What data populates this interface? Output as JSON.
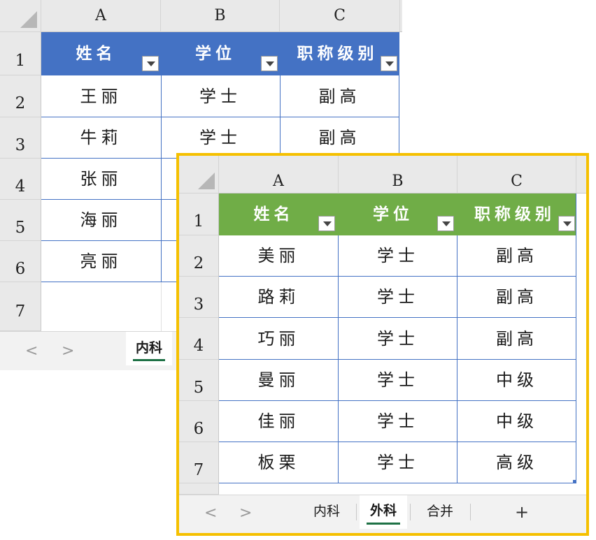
{
  "back_sheet": {
    "columns": [
      "A",
      "B",
      "C"
    ],
    "rows": [
      "1",
      "2",
      "3",
      "4",
      "5",
      "6",
      "7"
    ],
    "header_color": "#4472c4",
    "headers": [
      "姓名",
      "学位",
      "职称级别"
    ],
    "data": [
      [
        "王丽",
        "学士",
        "副高"
      ],
      [
        "牛莉",
        "学士",
        "副高"
      ],
      [
        "张丽",
        "",
        ""
      ],
      [
        "海丽",
        "",
        ""
      ],
      [
        "亮丽",
        "",
        ""
      ]
    ],
    "tabs": {
      "prev": "<",
      "next": ">",
      "active": "内科"
    }
  },
  "front_sheet": {
    "columns": [
      "A",
      "B",
      "C"
    ],
    "rows": [
      "1",
      "2",
      "3",
      "4",
      "5",
      "6",
      "7"
    ],
    "header_color": "#70ad47",
    "frame_color": "#f5c000",
    "headers": [
      "姓名",
      "学位",
      "职称级别"
    ],
    "data": [
      [
        "美丽",
        "学士",
        "副高"
      ],
      [
        "路莉",
        "学士",
        "副高"
      ],
      [
        "巧丽",
        "学士",
        "副高"
      ],
      [
        "曼丽",
        "学士",
        "中级"
      ],
      [
        "佳丽",
        "学士",
        "中级"
      ],
      [
        "板栗",
        "学士",
        "高级"
      ]
    ],
    "tabs": {
      "prev": "<",
      "next": ">",
      "items": [
        "内科",
        "外科",
        "合并"
      ],
      "add": "+",
      "active_index": 1
    }
  }
}
